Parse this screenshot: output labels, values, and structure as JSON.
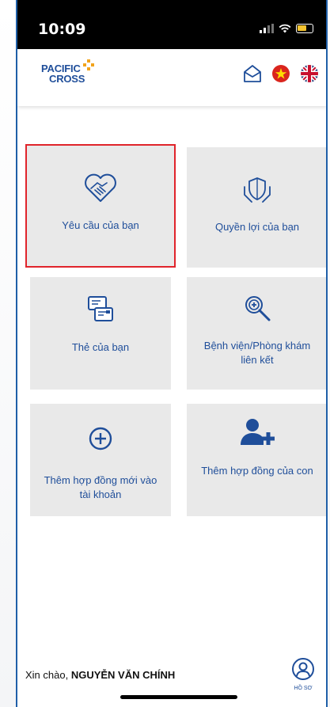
{
  "status_bar": {
    "time": "10:09",
    "battery_color": "#f4c430"
  },
  "header": {
    "logo": {
      "line1": "PACIFIC",
      "line2": "CROSS",
      "brand_color": "#1f4e9a",
      "cross_color": "#f2a31b"
    },
    "icons": [
      "mail-icon",
      "vietnam-flag-icon",
      "uk-flag-icon"
    ]
  },
  "tiles": [
    {
      "label": "Yêu cầu của bạn",
      "icon": "heart-handshake-icon",
      "selected": true
    },
    {
      "label": "Quyền lợi của bạn",
      "icon": "shield-hands-icon",
      "selected": false
    },
    {
      "label": "Thẻ của bạn",
      "icon": "cards-icon",
      "selected": false
    },
    {
      "label": "Bệnh viện/Phòng khám liên kết",
      "icon": "search-plus-icon",
      "selected": false
    },
    {
      "label": "Thêm hợp đồng mới vào tài khoản",
      "icon": "circle-plus-icon",
      "selected": false
    },
    {
      "label": "Thêm hợp đồng của con",
      "icon": "add-user-icon",
      "selected": false
    }
  ],
  "footer": {
    "greeting_prefix": "Xin chào, ",
    "user_name": "NGUYỄN VĂN CHÍNH",
    "profile_label": "HỒ SƠ"
  },
  "colors": {
    "primary": "#1f4e9a",
    "tile_bg": "#e9e9e9",
    "highlight": "#e0242b"
  }
}
